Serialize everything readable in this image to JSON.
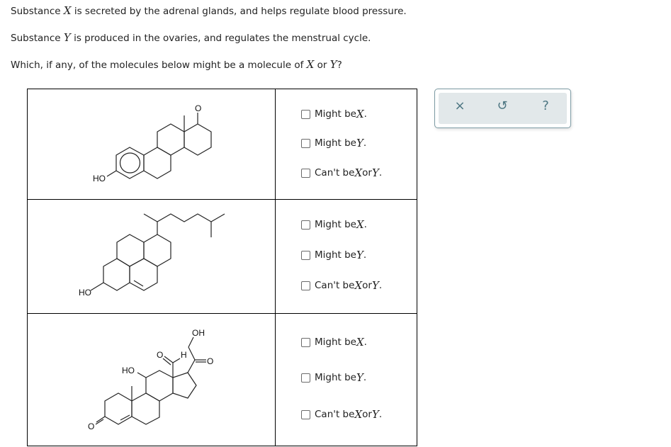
{
  "question": {
    "line1": {
      "pre": "Substance ",
      "var": "X",
      "post": " is secreted by the adrenal glands, and helps regulate blood pressure."
    },
    "line2": {
      "pre": "Substance ",
      "var": "Y",
      "post": " is produced in the ovaries, and regulates the menstrual cycle."
    },
    "line3": {
      "pre": "Which, if any, of the molecules below might be a molecule of ",
      "var1": "X",
      "mid": " or ",
      "var2": "Y",
      "post": "?"
    }
  },
  "rows": [
    {
      "molecule_labels": {
        "ho": "HO",
        "o": "O"
      },
      "options": [
        {
          "pre": "Might be ",
          "var": "X",
          "post": ".",
          "checked": false
        },
        {
          "pre": "Might be ",
          "var": "Y",
          "post": ".",
          "checked": false
        },
        {
          "pre": "Can't be ",
          "var1": "X",
          "mid": " or ",
          "var2": "Y",
          "post": ".",
          "checked": false
        }
      ]
    },
    {
      "molecule_labels": {
        "ho": "HO"
      },
      "options": [
        {
          "pre": "Might be ",
          "var": "X",
          "post": ".",
          "checked": false
        },
        {
          "pre": "Might be ",
          "var": "Y",
          "post": ".",
          "checked": false
        },
        {
          "pre": "Can't be ",
          "var1": "X",
          "mid": " or ",
          "var2": "Y",
          "post": ".",
          "checked": false
        }
      ]
    },
    {
      "molecule_labels": {
        "oh": "OH",
        "h": "H",
        "o_ald": "O",
        "o_ket": "O",
        "ho": "HO",
        "o_enone": "O"
      },
      "options": [
        {
          "pre": "Might be ",
          "var": "X",
          "post": ".",
          "checked": false
        },
        {
          "pre": "Might be ",
          "var": "Y",
          "post": ".",
          "checked": false
        },
        {
          "pre": "Can't be ",
          "var1": "X",
          "mid": " or ",
          "var2": "Y",
          "post": ".",
          "checked": false
        }
      ]
    }
  ],
  "toolbar": {
    "clear_icon": "×",
    "undo_icon": "↺",
    "help_icon": "?",
    "icon_color": "#4d7682"
  }
}
